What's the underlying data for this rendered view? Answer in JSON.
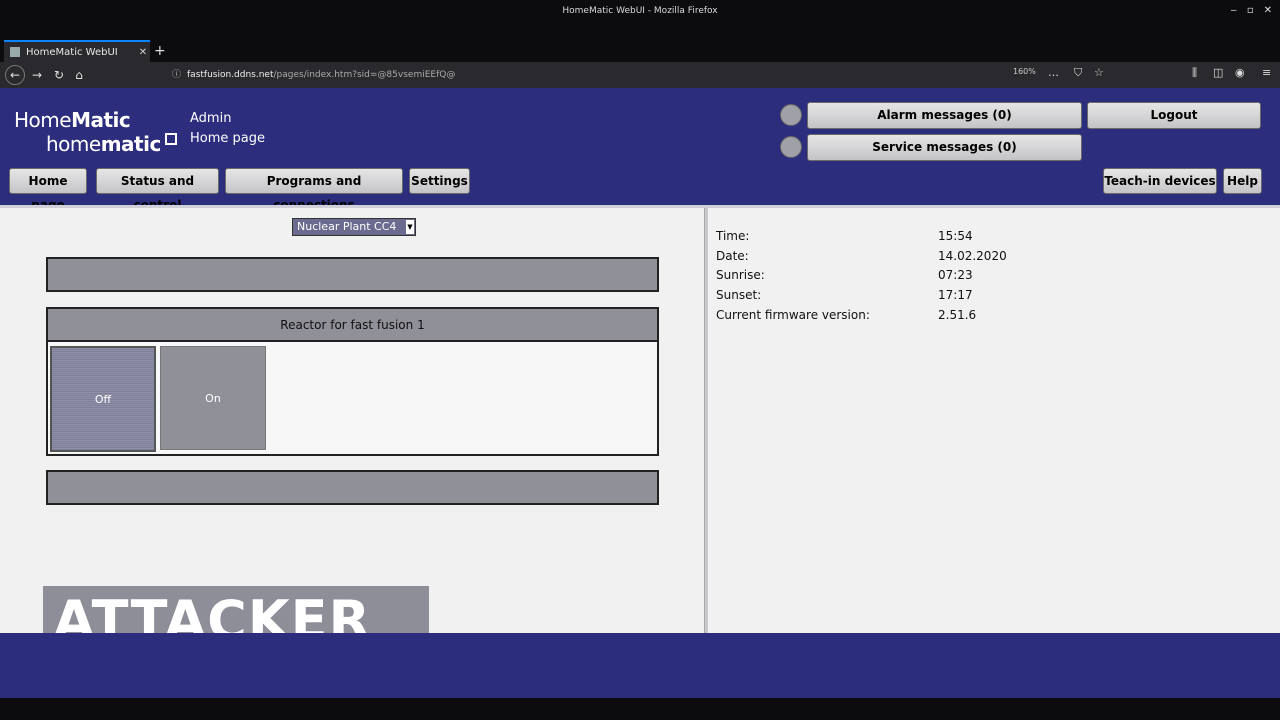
{
  "browser": {
    "window_title": "HomeMatic WebUI - Mozilla Firefox",
    "tab_title": "HomeMatic WebUI",
    "url_domain": "fastfusion.ddns.net",
    "url_path": "/pages/index.htm?sid=@85vsemiEEfQ@",
    "zoom": "160%"
  },
  "header": {
    "logo_line1_a": "Home",
    "logo_line1_b": "Matic",
    "logo_line2_a": "home",
    "logo_line2_b": "matic",
    "user": "Admin",
    "page": "Home page",
    "alarm_button": "Alarm messages (0)",
    "service_button": "Service messages (0)",
    "logout_button": "Logout"
  },
  "nav": {
    "home": "Home page",
    "status": "Status and control",
    "programs": "Programs and connections",
    "settings": "Settings",
    "teach_in": "Teach-in devices",
    "help": "Help"
  },
  "main": {
    "room_select": "Nuclear Plant CC4",
    "device_title": "Reactor for fast fusion 1",
    "off_label": "Off",
    "on_label": "On"
  },
  "info": {
    "time_label": "Time:",
    "time_value": "15:54",
    "date_label": "Date:",
    "date_value": "14.02.2020",
    "sunrise_label": "Sunrise:",
    "sunrise_value": "07:23",
    "sunset_label": "Sunset:",
    "sunset_value": "17:17",
    "firmware_label": "Current firmware version:",
    "firmware_value": "2.51.6"
  },
  "overlay": {
    "banner": "ATTACKER"
  }
}
